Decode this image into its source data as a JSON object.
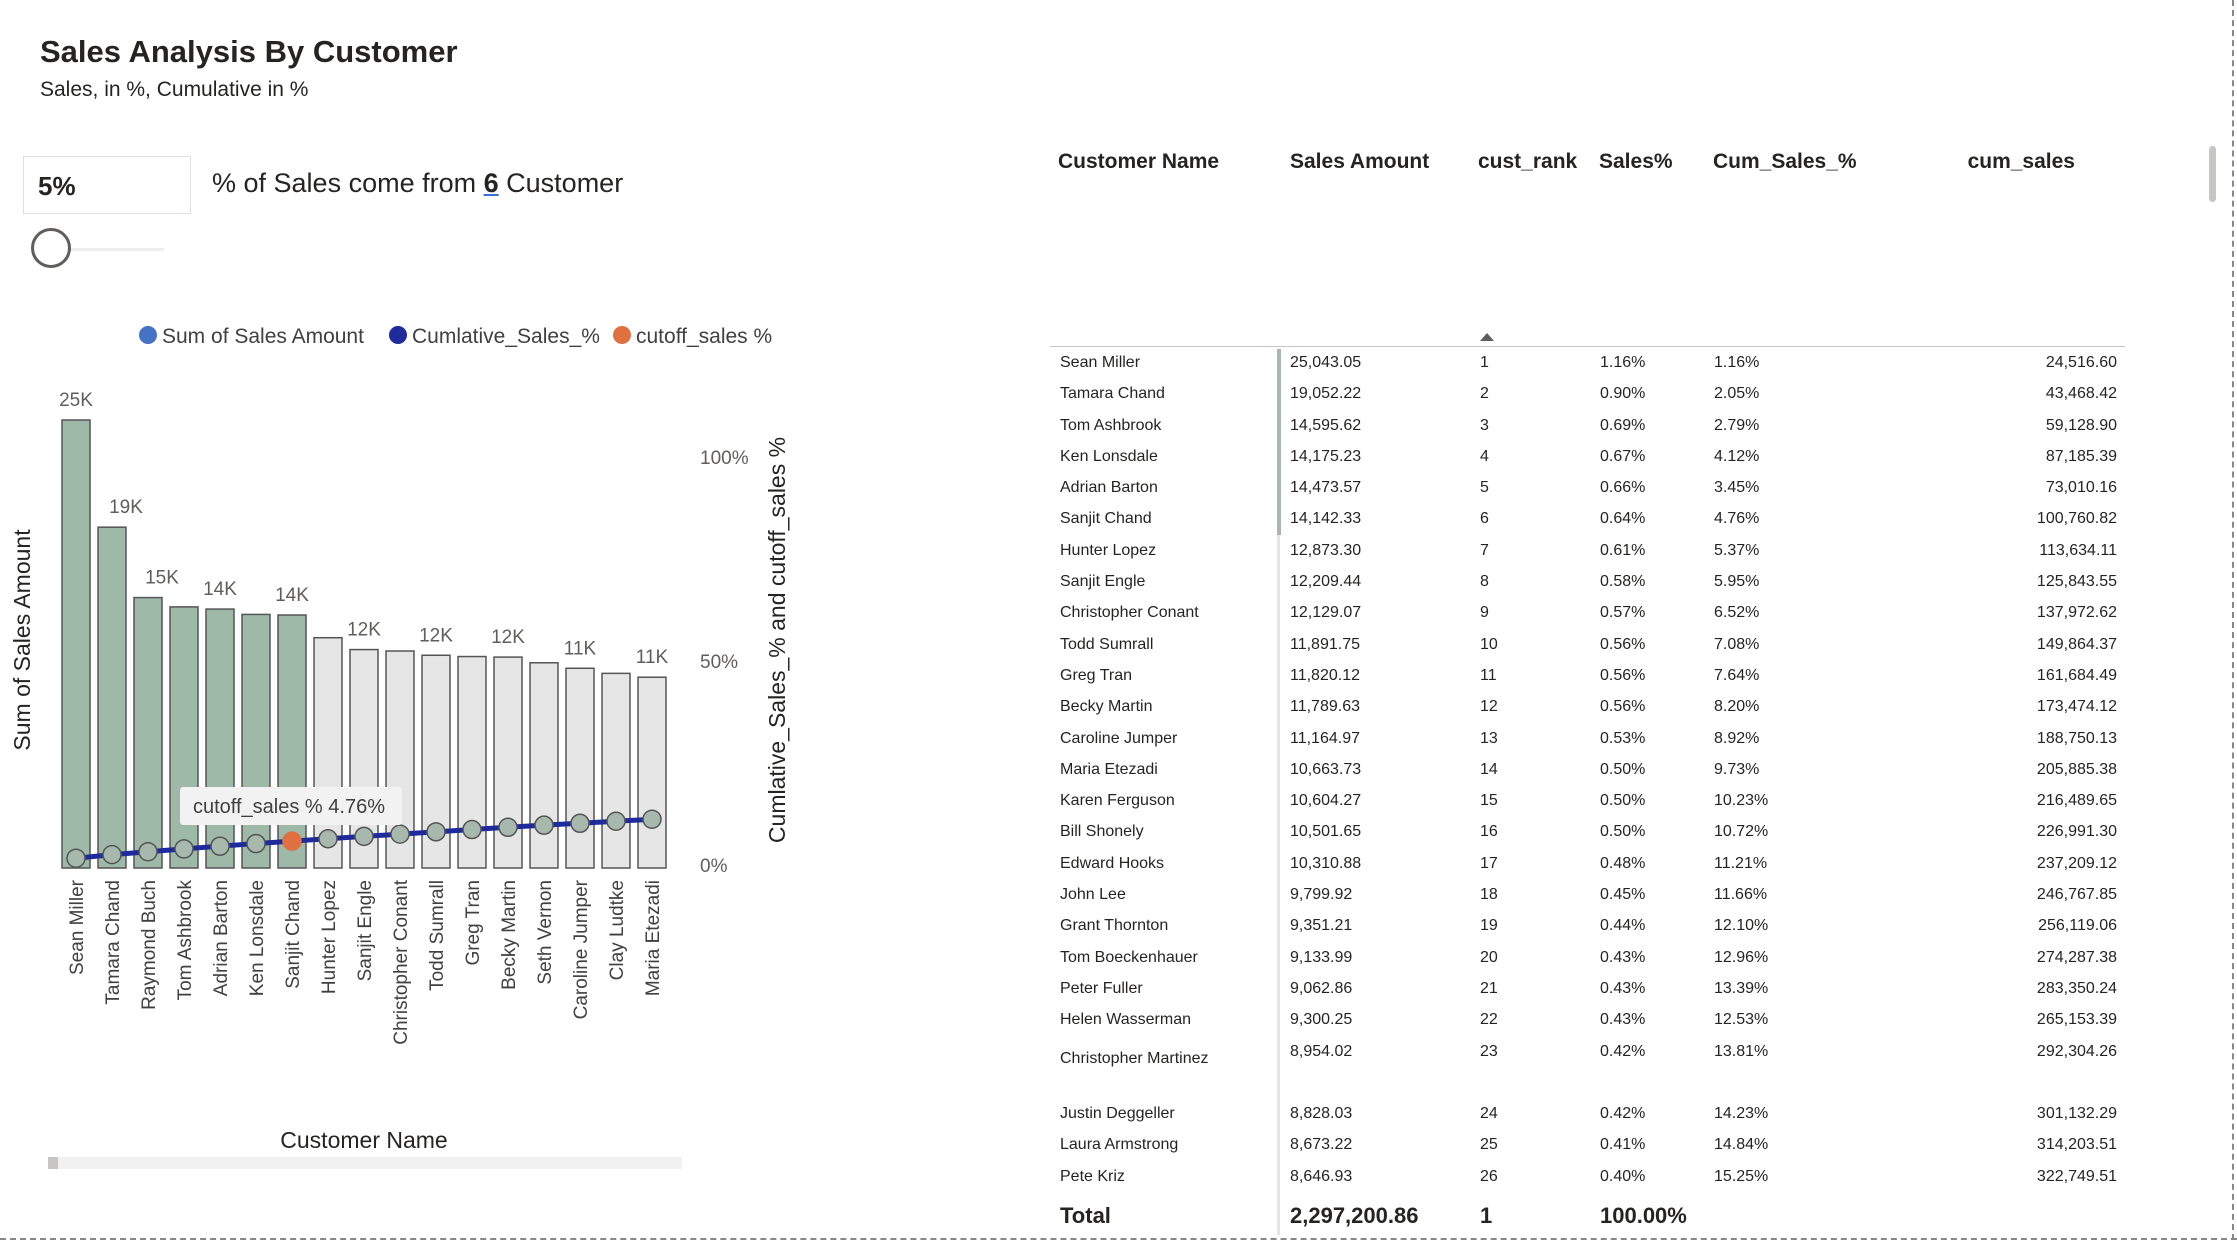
{
  "title": "Sales Analysis By Customer",
  "subtitle": "Sales, in %, Cumulative in %",
  "control": {
    "percent_value": "5%",
    "text_prefix": "% of Sales come from",
    "count": "6",
    "text_suffix": "Customer"
  },
  "chart_data": {
    "type": "bar",
    "legend": [
      "Sum of Sales Amount",
      "Cumlative_Sales_%",
      "cutoff_sales %"
    ],
    "legend_colors": [
      "#4472c4",
      "#1f2a9c",
      "#e07040"
    ],
    "xlabel": "Customer Name",
    "ylabel": "Sum of Sales Amount",
    "y2label": "Cumlative_Sales_% and cutoff_sales %",
    "y2ticks": [
      "100%",
      "50%",
      "0%"
    ],
    "categories": [
      "Sean Miller",
      "Tamara Chand",
      "Raymond Buch",
      "Tom Ashbrook",
      "Adrian Barton",
      "Ken Lonsdale",
      "Sanjit Chand",
      "Hunter Lopez",
      "Sanjit Engle",
      "Christopher Conant",
      "Todd Sumrall",
      "Greg Tran",
      "Becky Martin",
      "Seth Vernon",
      "Caroline Jumper",
      "Clay Ludtke",
      "Maria Etezadi"
    ],
    "values": [
      25043,
      19052,
      15117,
      14596,
      14474,
      14175,
      14142,
      12873,
      12209,
      12129,
      11892,
      11820,
      11790,
      11471,
      11165,
      10880,
      10664
    ],
    "bar_labels": [
      "25K",
      "19K",
      "15K",
      "",
      "14K",
      "",
      "14K",
      "",
      "12K",
      "",
      "12K",
      "",
      "12K",
      "",
      "11K",
      "",
      "11K"
    ],
    "highlighted_count": 7,
    "cumulative_pct": [
      1.16,
      2.05,
      2.75,
      3.45,
      4.12,
      4.76,
      5.37,
      5.95,
      6.52,
      7.08,
      7.64,
      8.2,
      8.75,
      9.27,
      9.73,
      10.23,
      10.72
    ],
    "cutoff_point": {
      "category": "Sanjit Chand",
      "value": 4.76
    },
    "tooltip": "cutoff_sales % 4.76%",
    "ylim": [
      0,
      25043
    ],
    "y2lim": [
      0,
      100
    ]
  },
  "table": {
    "headers": [
      "Customer Name",
      "Sales Amount",
      "cust_rank",
      "Sales%",
      "Cum_Sales_%",
      "cum_sales"
    ],
    "rows": [
      [
        "Sean Miller",
        "25,043.05",
        "1",
        "1.16%",
        "1.16%",
        "24,516.60"
      ],
      [
        "Tamara Chand",
        "19,052.22",
        "2",
        "0.90%",
        "2.05%",
        "43,468.42"
      ],
      [
        "Tom Ashbrook",
        "14,595.62",
        "3",
        "0.69%",
        "2.79%",
        "59,128.90"
      ],
      [
        "Ken Lonsdale",
        "14,175.23",
        "4",
        "0.67%",
        "4.12%",
        "87,185.39"
      ],
      [
        "Adrian Barton",
        "14,473.57",
        "5",
        "0.66%",
        "3.45%",
        "73,010.16"
      ],
      [
        "Sanjit Chand",
        "14,142.33",
        "6",
        "0.64%",
        "4.76%",
        "100,760.82"
      ],
      [
        "Hunter Lopez",
        "12,873.30",
        "7",
        "0.61%",
        "5.37%",
        "113,634.11"
      ],
      [
        "Sanjit Engle",
        "12,209.44",
        "8",
        "0.58%",
        "5.95%",
        "125,843.55"
      ],
      [
        "Christopher Conant",
        "12,129.07",
        "9",
        "0.57%",
        "6.52%",
        "137,972.62"
      ],
      [
        "Todd Sumrall",
        "11,891.75",
        "10",
        "0.56%",
        "7.08%",
        "149,864.37"
      ],
      [
        "Greg Tran",
        "11,820.12",
        "11",
        "0.56%",
        "7.64%",
        "161,684.49"
      ],
      [
        "Becky Martin",
        "11,789.63",
        "12",
        "0.56%",
        "8.20%",
        "173,474.12"
      ],
      [
        "Caroline Jumper",
        "11,164.97",
        "13",
        "0.53%",
        "8.92%",
        "188,750.13"
      ],
      [
        "Maria Etezadi",
        "10,663.73",
        "14",
        "0.50%",
        "9.73%",
        "205,885.38"
      ],
      [
        "Karen Ferguson",
        "10,604.27",
        "15",
        "0.50%",
        "10.23%",
        "216,489.65"
      ],
      [
        "Bill Shonely",
        "10,501.65",
        "16",
        "0.50%",
        "10.72%",
        "226,991.30"
      ],
      [
        "Edward Hooks",
        "10,310.88",
        "17",
        "0.48%",
        "11.21%",
        "237,209.12"
      ],
      [
        "John Lee",
        "9,799.92",
        "18",
        "0.45%",
        "11.66%",
        "246,767.85"
      ],
      [
        "Grant Thornton",
        "9,351.21",
        "19",
        "0.44%",
        "12.10%",
        "256,119.06"
      ],
      [
        "Tom Boeckenhauer",
        "9,133.99",
        "20",
        "0.43%",
        "12.96%",
        "274,287.38"
      ],
      [
        "Peter Fuller",
        "9,062.86",
        "21",
        "0.43%",
        "13.39%",
        "283,350.24"
      ],
      [
        "Helen Wasserman",
        "9,300.25",
        "22",
        "0.43%",
        "12.53%",
        "265,153.39"
      ],
      [
        "Christopher Martinez",
        "8,954.02",
        "23",
        "0.42%",
        "13.81%",
        "292,304.26"
      ],
      [
        "Justin Deggeller",
        "8,828.03",
        "24",
        "0.42%",
        "14.23%",
        "301,132.29"
      ],
      [
        "Laura Armstrong",
        "8,673.22",
        "25",
        "0.41%",
        "14.84%",
        "314,203.51"
      ],
      [
        "Pete Kriz",
        "8,646.93",
        "26",
        "0.40%",
        "15.25%",
        "322,749.51"
      ]
    ],
    "total": {
      "label": "Total",
      "sales": "2,297,200.86",
      "rank": "1",
      "pct": "100.00%"
    }
  }
}
